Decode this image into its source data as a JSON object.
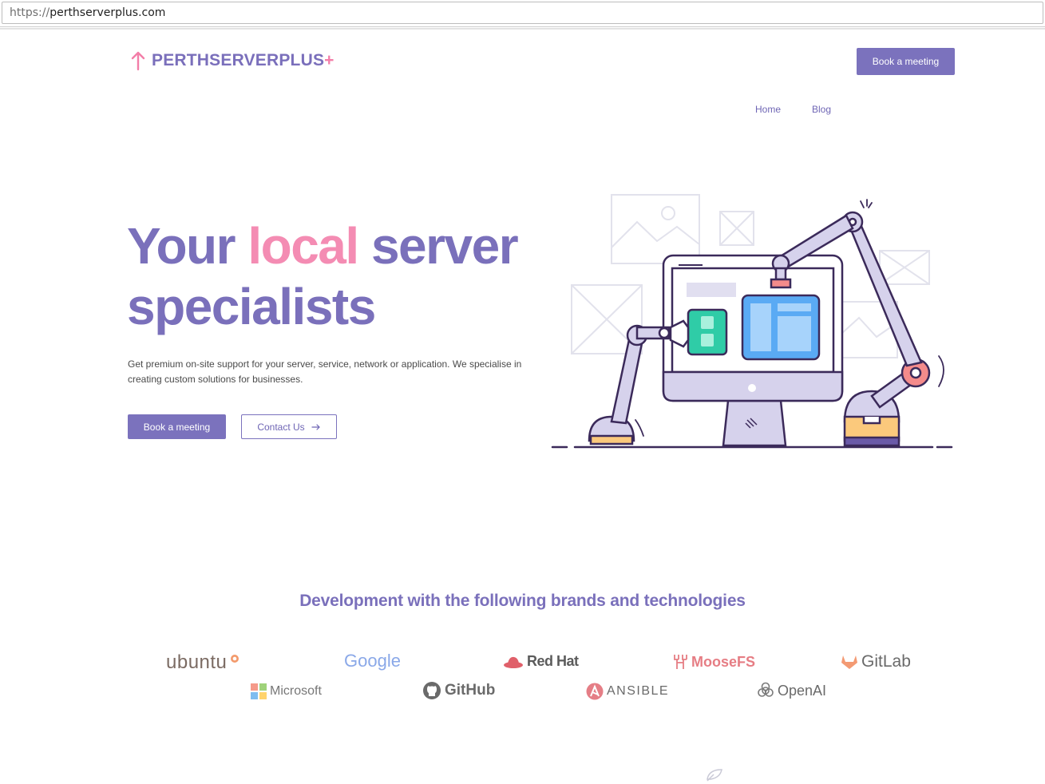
{
  "browser": {
    "url_scheme": "https://",
    "url_host": "perthserverplus.com"
  },
  "header": {
    "logo_text": "PERTHSERVERPLUS",
    "logo_plus": "+",
    "nav": {
      "home": "Home",
      "blog": "Blog",
      "cta": "Book a meeting"
    }
  },
  "hero": {
    "title_part1": "Your ",
    "title_accent": "local",
    "title_part2": " server",
    "title_line2": "specialists",
    "description_line1": "Get premium on-site support for your server, service, network or application. We specialise in",
    "description_line2": "creating custom solutions for businesses.",
    "primary_button": "Book a meeting",
    "secondary_button": "Contact Us"
  },
  "brands": {
    "title": "Development with the following brands and technologies",
    "items": [
      {
        "name": "ubuntu",
        "icon": "ubuntu-icon"
      },
      {
        "name": "Google",
        "icon": "none"
      },
      {
        "name": "Red Hat",
        "icon": "redhat-icon"
      },
      {
        "name": "MooseFS",
        "icon": "moose-icon"
      },
      {
        "name": "GitLab",
        "icon": "gitlab-icon"
      },
      {
        "name": "Microsoft",
        "icon": "microsoft-icon"
      },
      {
        "name": "GitHub",
        "icon": "github-icon"
      },
      {
        "name": "ANSIBLE",
        "icon": "ansible-icon"
      },
      {
        "name": "OpenAI",
        "icon": "openai-icon"
      }
    ]
  },
  "colors": {
    "brand_purple": "#7a70bb",
    "accent_pink": "#f48cb3"
  }
}
